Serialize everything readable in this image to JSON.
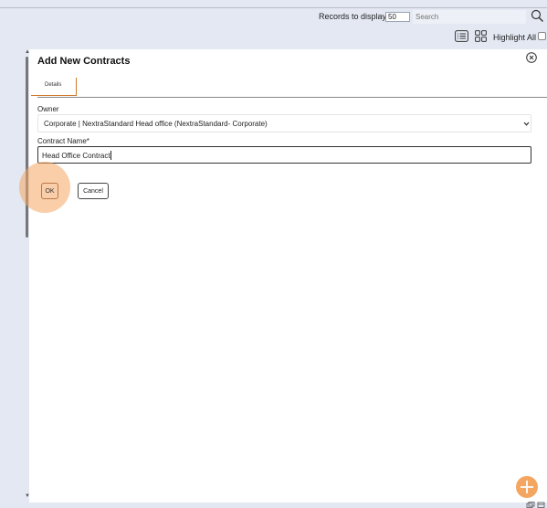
{
  "topbar": {
    "records_label": "Records to display",
    "records_value": "50",
    "search_placeholder": "Search"
  },
  "viewbar": {
    "highlight_label": "Highlight All"
  },
  "dialog": {
    "title": "Add New Contracts",
    "tabs": [
      {
        "label": "Details",
        "active": true
      }
    ],
    "owner": {
      "label": "Owner",
      "value": "Corporate | NextraStandard Head office (NextraStandard- Corporate)"
    },
    "contract_name": {
      "label": "Contract Name*",
      "value": "Head Office Contract"
    },
    "ok_label": "OK",
    "cancel_label": "Cancel"
  },
  "icons": {
    "search": "search-icon",
    "list_view": "list-view-icon",
    "grid_view": "grid-view-icon",
    "close": "close-icon",
    "dropdown": "chevron-down-icon",
    "add": "plus-icon"
  },
  "colors": {
    "background": "#e3e8f3",
    "panel": "#ffffff",
    "accent": "#f4a560",
    "tab_underline": "#d07a2a"
  }
}
